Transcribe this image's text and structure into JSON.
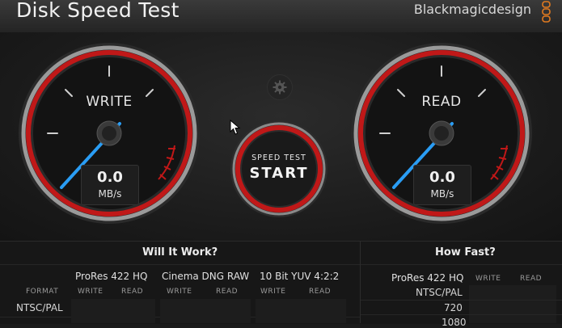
{
  "app": {
    "title": "Disk Speed Test",
    "brand": "Blackmagicdesign"
  },
  "gauges": {
    "write": {
      "label": "WRITE",
      "value": "0.0",
      "unit": "MB/s",
      "ring_color": "#c01818"
    },
    "read": {
      "label": "READ",
      "value": "0.0",
      "unit": "MB/s",
      "ring_color": "#c01818"
    }
  },
  "start_button": {
    "line1": "SPEED TEST",
    "line2": "START"
  },
  "will_it_work": {
    "title": "Will It Work?",
    "columns": [
      {
        "name": "ProRes 422 HQ",
        "sub": [
          "WRITE",
          "READ"
        ]
      },
      {
        "name": "Cinema DNG RAW",
        "sub": [
          "WRITE",
          "READ"
        ]
      },
      {
        "name": "10 Bit YUV 4:2:2",
        "sub": [
          "WRITE",
          "READ"
        ]
      }
    ],
    "format_label": "FORMAT",
    "rows": [
      "NTSC/PAL"
    ]
  },
  "how_fast": {
    "title": "How Fast?",
    "format": "ProRes 422 HQ",
    "sub": [
      "WRITE",
      "READ"
    ],
    "rows": [
      "NTSC/PAL",
      "720",
      "1080"
    ]
  },
  "colors": {
    "accent_red": "#c01818",
    "needle_blue": "#2a9df4"
  }
}
